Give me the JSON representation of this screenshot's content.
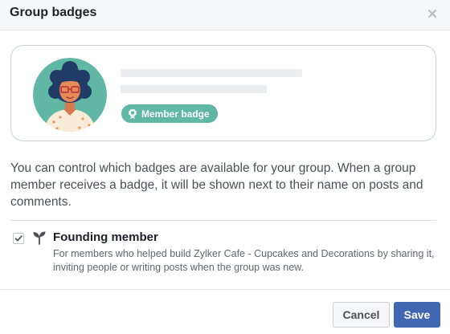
{
  "dialog": {
    "title": "Group badges",
    "close_icon": "close-icon"
  },
  "preview": {
    "badge_icon": "badge-seal-icon",
    "badge_label": "Member badge",
    "badge_color": "#5fb7a4"
  },
  "description": "You can control which badges are available for your group. When a group member receives a badge, it will be shown next to their name on posts and comments.",
  "options": [
    {
      "checked": true,
      "icon": "sprout-icon",
      "title": "Founding member",
      "description": "For members who helped build Zylker Cafe - Cupcakes and Decorations by sharing it, inviting people or writing posts when the group was new."
    }
  ],
  "footer": {
    "cancel_label": "Cancel",
    "save_label": "Save"
  },
  "colors": {
    "primary": "#4267b2",
    "header_bg": "#f5f6f7",
    "avatar_bg": "#5fb7a4"
  }
}
